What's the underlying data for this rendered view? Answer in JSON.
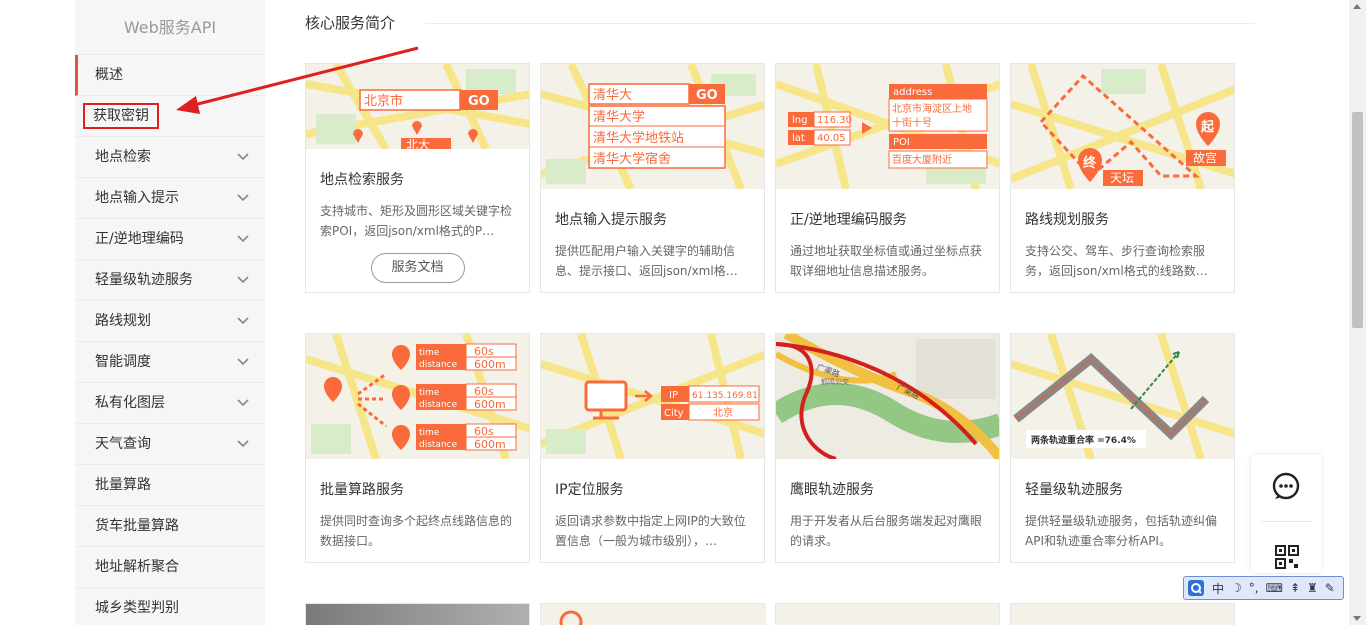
{
  "sidebar": {
    "title": "Web服务API",
    "items": [
      {
        "label": "概述",
        "expandable": false
      },
      {
        "label": "获取密钥",
        "expandable": false
      },
      {
        "label": "地点检索",
        "expandable": true
      },
      {
        "label": "地点输入提示",
        "expandable": true
      },
      {
        "label": "正/逆地理编码",
        "expandable": true
      },
      {
        "label": "轻量级轨迹服务",
        "expandable": true
      },
      {
        "label": "路线规划",
        "expandable": true
      },
      {
        "label": "智能调度",
        "expandable": true
      },
      {
        "label": "私有化图层",
        "expandable": true
      },
      {
        "label": "天气查询",
        "expandable": true
      },
      {
        "label": "批量算路",
        "expandable": false
      },
      {
        "label": "货车批量算路",
        "expandable": false
      },
      {
        "label": "地址解析聚合",
        "expandable": false
      },
      {
        "label": "城乡类型判别",
        "expandable": false
      }
    ]
  },
  "main": {
    "section_title": "核心服务简介",
    "cards": [
      {
        "title": "地点检索服务",
        "desc": "支持城市、矩形及圆形区域关键字检索POI，返回json/xml格式的P…",
        "button": "服务文档"
      },
      {
        "title": "地点输入提示服务",
        "desc": "提供匹配用户输入关键字的辅助信息、提示接口、返回json/xml格…"
      },
      {
        "title": "正/逆地理编码服务",
        "desc": "通过地址获取坐标值或通过坐标点获取详细地址信息描述服务。"
      },
      {
        "title": "路线规划服务",
        "desc": "支持公交、驾车、步行查询检索服务，返回json/xml格式的线路数…"
      },
      {
        "title": "批量算路服务",
        "desc": "提供同时查询多个起终点线路信息的数据接口。"
      },
      {
        "title": "IP定位服务",
        "desc": "返回请求参数中指定上网IP的大致位置信息（一般为城市级别），…"
      },
      {
        "title": "鹰眼轨迹服务",
        "desc": "用于开发者从后台服务端发起对鹰眼的请求。"
      },
      {
        "title": "轻量级轨迹服务",
        "desc": "提供轻量级轨迹服务，包括轨迹纠偏API和轨迹重合率分析API。"
      }
    ],
    "thumbs": {
      "search": {
        "input": "北京市",
        "go": "GO",
        "result": "北大"
      },
      "suggest": {
        "input": "清华大",
        "go": "GO",
        "options": [
          "清华大学",
          "清华大学地铁站",
          "清华大学宿舍"
        ]
      },
      "geocode": {
        "lng_label": "lng",
        "lng": "116.30",
        "lat_label": "lat",
        "lat": "40.05",
        "address_label": "address",
        "address_line1": "北京市海淀区上地",
        "address_line2": "十街十号",
        "poi_label": "POI",
        "poi": "百度大厦附近"
      },
      "route": {
        "start_mark": "起",
        "start_name": "故宫",
        "end_mark": "终",
        "end_name": "天坛"
      },
      "batch": {
        "rows": [
          {
            "time_label": "time",
            "time": "60s",
            "distance_label": "distance",
            "distance": "600m"
          },
          {
            "time_label": "time",
            "time": "60s",
            "distance_label": "distance",
            "distance": "600m"
          },
          {
            "time_label": "time",
            "time": "60s",
            "distance_label": "distance",
            "distance": "600m"
          }
        ]
      },
      "ip": {
        "ip_label": "IP",
        "ip": "61.135.169.81",
        "city_label": "City",
        "city": "北京"
      },
      "trace": {
        "road1": "广渠路",
        "road2": "广渠路",
        "place": "鹤鸣公交"
      },
      "lite_trace": {
        "rate_text": "两条轨迹重合率 =76.4%"
      }
    }
  },
  "ime": {
    "items": [
      "中",
      "☽",
      "°,",
      "⌨",
      "⇞",
      "♜",
      "✎"
    ]
  },
  "colors": {
    "accent": "#fa6a3a",
    "active_bar": "#e8514a",
    "highlight_box": "#e02020",
    "arrow": "#e02020"
  }
}
